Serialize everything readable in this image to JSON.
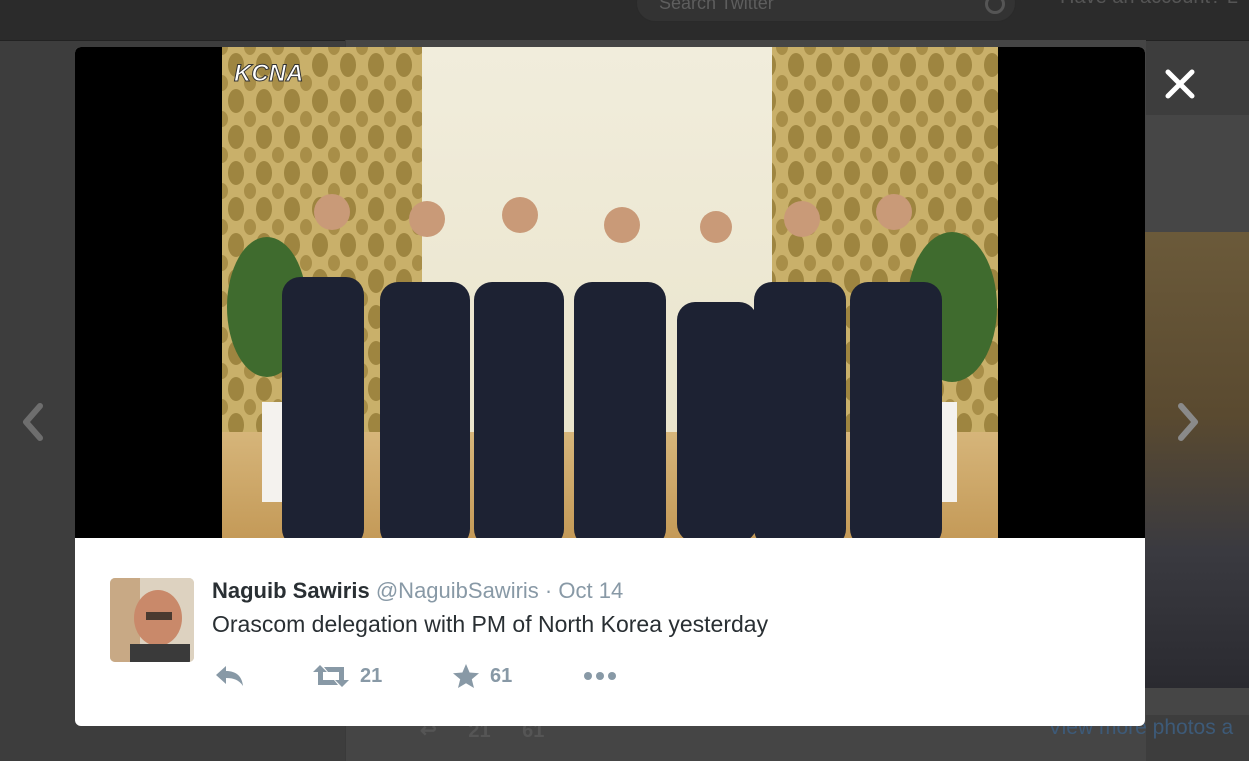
{
  "background": {
    "search_placeholder": "Search Twitter",
    "account_prompt": "Have an account? L",
    "retweet_count": "21",
    "favorite_count": "61",
    "view_more": "View more photos a"
  },
  "photo": {
    "watermark": "KCNA"
  },
  "tweet": {
    "fullname": "Naguib Sawiris",
    "handle": "@NaguibSawiris",
    "separator": "·",
    "timestamp": "Oct 14",
    "text": "Orascom delegation with PM of North Korea yesterday",
    "retweet_count": "21",
    "favorite_count": "61"
  },
  "icons": {
    "close": "close-icon",
    "prev": "chevron-left-icon",
    "next": "chevron-right-icon",
    "reply": "reply-icon",
    "retweet": "retweet-icon",
    "favorite": "star-icon",
    "more": "more-dots-icon"
  },
  "colors": {
    "text_primary": "#292f33",
    "text_secondary": "#8899a6",
    "link": "#3d5a78"
  }
}
